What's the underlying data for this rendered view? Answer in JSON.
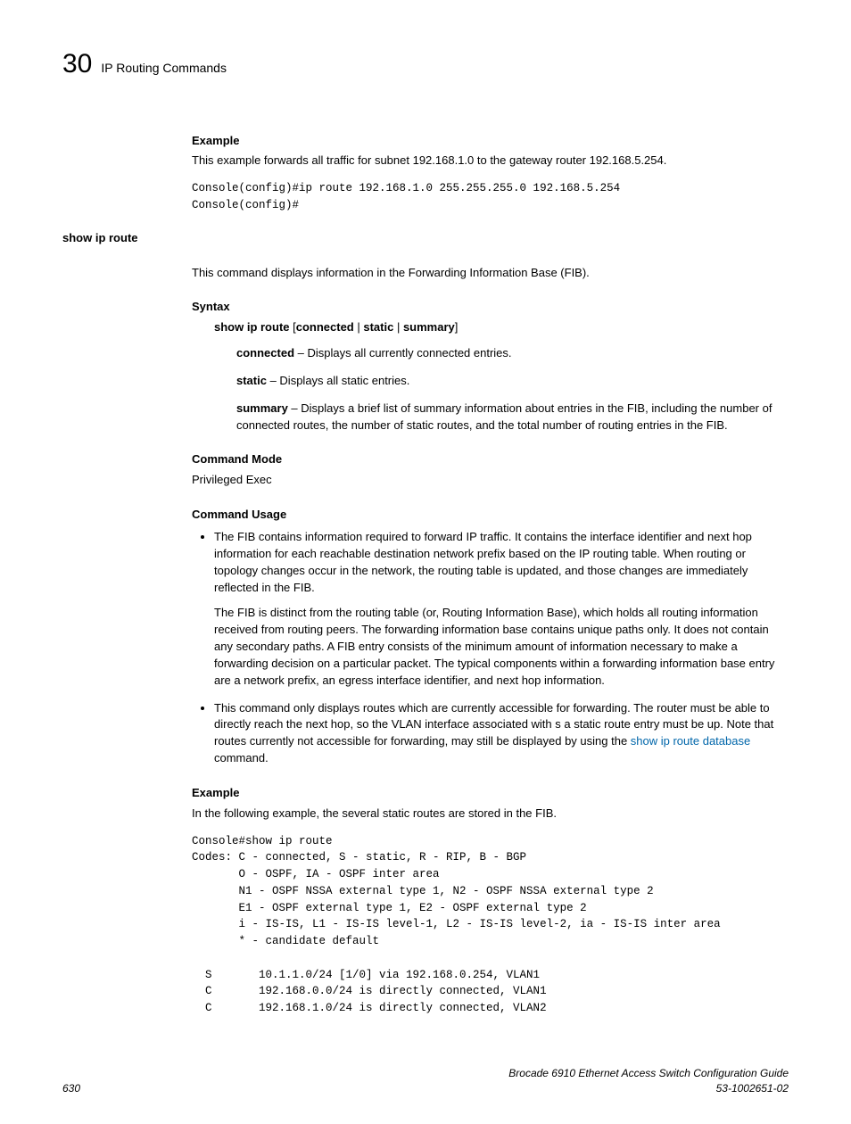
{
  "header": {
    "chapter_number": "30",
    "chapter_title": "IP Routing Commands"
  },
  "example1": {
    "heading": "Example",
    "text": "This example forwards all traffic for subnet 192.168.1.0 to the gateway router 192.168.5.254.",
    "code": "Console(config)#ip route 192.168.1.0 255.255.255.0 192.168.5.254\nConsole(config)#"
  },
  "command": {
    "name": "show ip route",
    "description": "This command displays information in the Forwarding Information Base (FIB)."
  },
  "syntax": {
    "heading": "Syntax",
    "line_bold1": "show ip route",
    "line_plain": " [",
    "line_bold2": "connected",
    "line_sep1": " | ",
    "line_bold3": "static",
    "line_sep2": " | ",
    "line_bold4": "summary",
    "line_close": "]",
    "opt1_b": "connected",
    "opt1_t": " – Displays all currently connected entries.",
    "opt2_b": "static",
    "opt2_t": " – Displays all static entries.",
    "opt3_b": "summary",
    "opt3_t": " – Displays a brief list of summary information about entries in the FIB, including the number of connected routes, the number of static routes, and the total number of routing entries in the FIB."
  },
  "mode": {
    "heading": "Command Mode",
    "text": "Privileged Exec"
  },
  "usage": {
    "heading": "Command Usage",
    "bullet1_p1": "The FIB contains information required to forward IP traffic. It contains the interface identifier and next hop information for each reachable destination network prefix based on the IP routing table. When routing or topology changes occur in the network, the routing table is updated, and those changes are immediately reflected in the FIB.",
    "bullet1_p2": "The FIB is distinct from the routing table (or, Routing Information Base), which holds all routing information received from routing peers. The forwarding information base contains unique paths only. It does not contain any secondary paths. A FIB entry consists of the minimum amount of information necessary to make a forwarding decision on a particular packet. The typical components within a forwarding information base entry are a network prefix, an egress interface identifier, and next hop information.",
    "bullet2_pre": "This command only displays routes which are currently accessible for forwarding. The router must be able to directly reach the next hop, so the VLAN interface associated with s a static route entry must be up. Note that routes currently not accessible for forwarding, may still be displayed by using the ",
    "bullet2_link": "show ip route database",
    "bullet2_post": " command."
  },
  "example2": {
    "heading": "Example",
    "text": "In the following example, the several static routes are stored in the FIB.",
    "code": "Console#show ip route\nCodes: C - connected, S - static, R - RIP, B - BGP\n       O - OSPF, IA - OSPF inter area\n       N1 - OSPF NSSA external type 1, N2 - OSPF NSSA external type 2\n       E1 - OSPF external type 1, E2 - OSPF external type 2\n       i - IS-IS, L1 - IS-IS level-1, L2 - IS-IS level-2, ia - IS-IS inter area\n       * - candidate default\n\n  S       10.1.1.0/24 [1/0] via 192.168.0.254, VLAN1\n  C       192.168.0.0/24 is directly connected, VLAN1\n  C       192.168.1.0/24 is directly connected, VLAN2"
  },
  "footer": {
    "page": "630",
    "title": "Brocade 6910 Ethernet Access Switch Configuration Guide",
    "docnum": "53-1002651-02"
  }
}
